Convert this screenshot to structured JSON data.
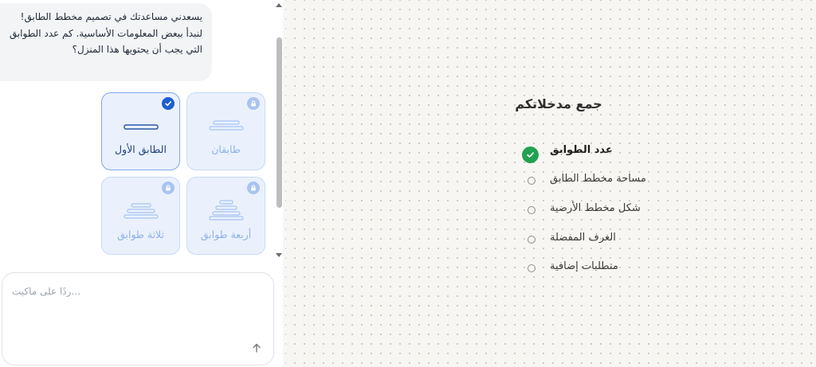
{
  "chat": {
    "assistant_message": "يسعدني مساعدتك في تصميم مخطط الطابق! لنبدأ ببعض المعلومات الأساسية. كم عدد الطوابق التي يجب أن يحتويها هذا المنزل؟",
    "options": [
      {
        "label": "الطابق الأول",
        "state": "selected",
        "icon": "single-floor-icon"
      },
      {
        "label": "طابقان",
        "state": "locked",
        "icon": "two-floors-icon"
      },
      {
        "label": "ثلاثة طوابق",
        "state": "locked",
        "icon": "three-floors-icon"
      },
      {
        "label": "أربعة طوابق",
        "state": "locked",
        "icon": "four-floors-icon"
      }
    ],
    "input_placeholder": "...ردًا على ماكيت"
  },
  "steps": {
    "title": "جمع مدخلاتكم",
    "items": [
      {
        "label": "عدد الطوابق",
        "status": "done"
      },
      {
        "label": "مساحة مخطط الطابق",
        "status": "pending"
      },
      {
        "label": "شكل مخطط الأرضية",
        "status": "pending"
      },
      {
        "label": "الغرف المفضلة",
        "status": "pending"
      },
      {
        "label": "متطلبات إضافية",
        "status": "pending"
      }
    ]
  },
  "colors": {
    "accent_blue": "#1e5fcf",
    "card_bg": "#eaf1fd",
    "done_green": "#22a152",
    "canvas_bg": "#f7f6f2"
  }
}
